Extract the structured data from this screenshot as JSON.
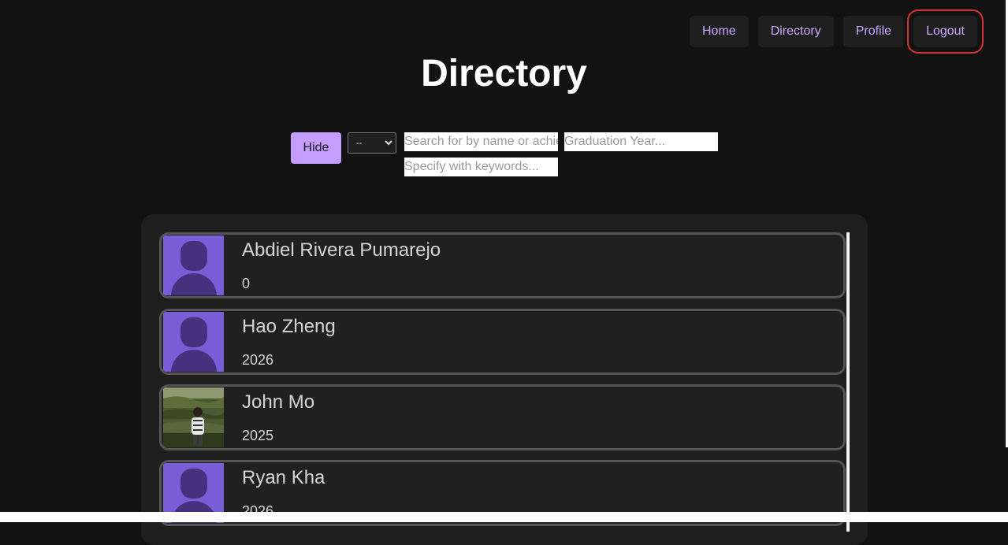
{
  "nav": {
    "items": [
      {
        "label": "Home"
      },
      {
        "label": "Directory"
      },
      {
        "label": "Profile"
      },
      {
        "label": "Logout"
      }
    ]
  },
  "page": {
    "title": "Directory"
  },
  "controls": {
    "hide_label": "Hide",
    "select_value": "--",
    "search_placeholder": "Search for by name or achievements...",
    "grad_year_placeholder": "Graduation Year...",
    "keywords_placeholder": "Specify with keywords..."
  },
  "people": [
    {
      "name": "Abdiel Rivera Pumarejo",
      "year": "0",
      "avatar": "default-avatar"
    },
    {
      "name": "Hao Zheng",
      "year": "2026",
      "avatar": "default-avatar"
    },
    {
      "name": "John Mo",
      "year": "2025",
      "avatar": "photo"
    },
    {
      "name": "Ryan Kha",
      "year": "2026",
      "avatar": "default-avatar"
    }
  ],
  "colors": {
    "accent": "#c59cff",
    "nav_text": "#c9a6ff",
    "avatar_bg": "#7a5cd6",
    "avatar_fg": "#47317f",
    "highlight": "#d33232"
  }
}
